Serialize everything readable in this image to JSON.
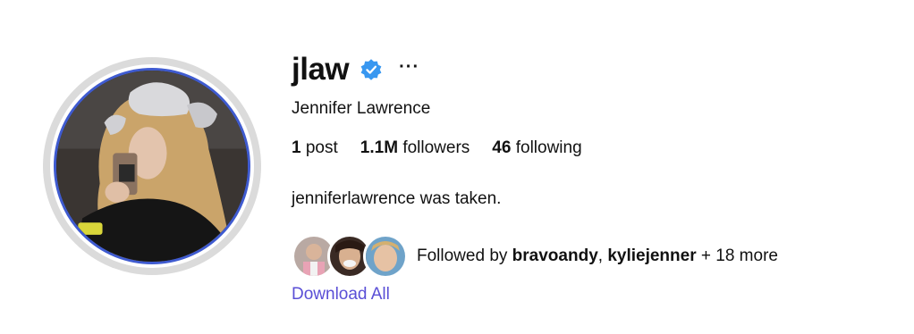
{
  "profile": {
    "username": "jlaw",
    "more_icon": "···",
    "full_name": "Jennifer Lawrence",
    "bio": "jenniferlawrence was taken."
  },
  "stats": {
    "posts_count": "1",
    "posts_label": "post",
    "followers_count": "1.1M",
    "followers_label": "followers",
    "following_count": "46",
    "following_label": "following"
  },
  "followed_by": {
    "prefix": "Followed by",
    "user1": "bravoandy",
    "separator": ", ",
    "user2": "kyliejenner",
    "suffix": " + 18 more"
  },
  "actions": {
    "download_all": "Download All"
  },
  "colors": {
    "verified_badge": "#3897f0",
    "avatar_ring": "#3f5bd0",
    "link": "#5a4fd6"
  }
}
